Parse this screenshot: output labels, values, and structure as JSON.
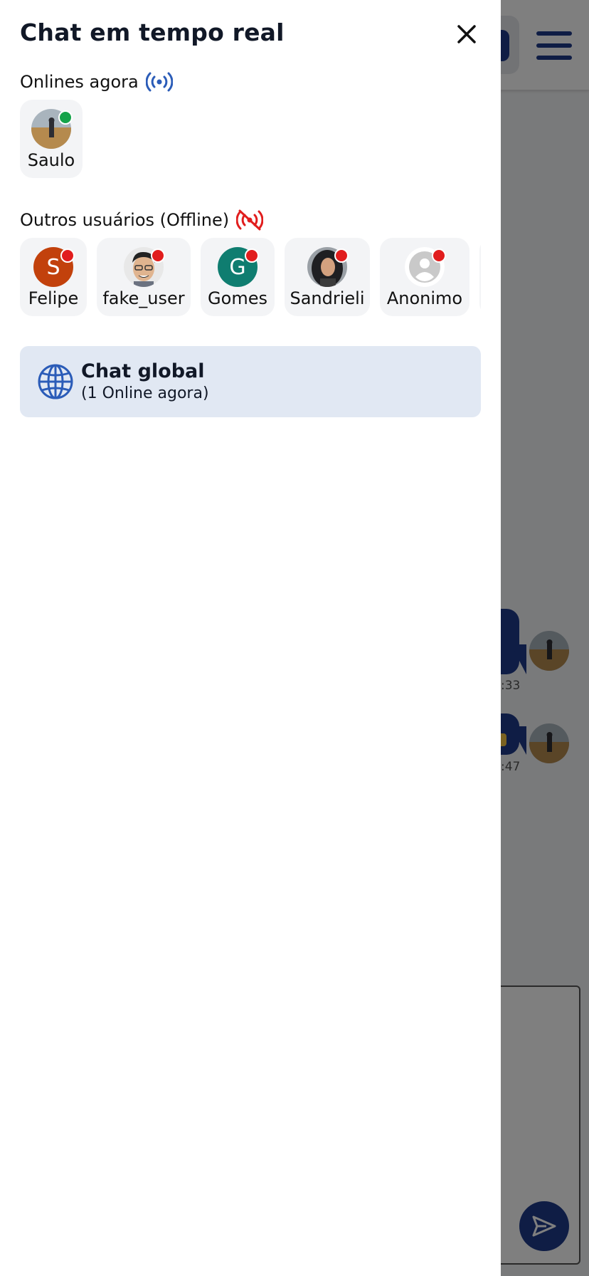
{
  "drawer": {
    "title": "Chat em tempo real",
    "close_icon": "close-icon"
  },
  "online_section": {
    "label": "Onlines agora",
    "icon": "broadcast-icon",
    "icon_color": "#2b5cb8",
    "users": [
      {
        "name": "Saulo",
        "avatar": "photo",
        "status": "online"
      }
    ]
  },
  "offline_section": {
    "label": "Outros usuários (Offline)",
    "icon": "broadcast-off-icon",
    "icon_color": "#e11d1d",
    "users": [
      {
        "name": "Felipe",
        "avatar": "letter",
        "letter": "S",
        "color": "#c2410c",
        "status": "offline"
      },
      {
        "name": "fake_user",
        "avatar": "photo",
        "status": "offline"
      },
      {
        "name": "Gomes",
        "avatar": "letter",
        "letter": "G",
        "color": "#0f7d70",
        "status": "offline"
      },
      {
        "name": "Sandrieli",
        "avatar": "photo",
        "status": "offline"
      },
      {
        "name": "Anonimo",
        "avatar": "placeholder",
        "status": "offline"
      }
    ]
  },
  "global_chat": {
    "icon": "globe-icon",
    "title": "Chat global",
    "subtitle": "(1 Online agora)"
  },
  "background": {
    "menu_icon": "hamburger-menu-icon",
    "messages": [
      {
        "time": ":33"
      },
      {
        "time": ":47"
      }
    ],
    "send_icon": "send-icon"
  },
  "colors": {
    "primary": "#1e3a8a",
    "online": "#16a34a",
    "offline": "#e11d1d",
    "global_card_bg": "#e1e8f3"
  }
}
